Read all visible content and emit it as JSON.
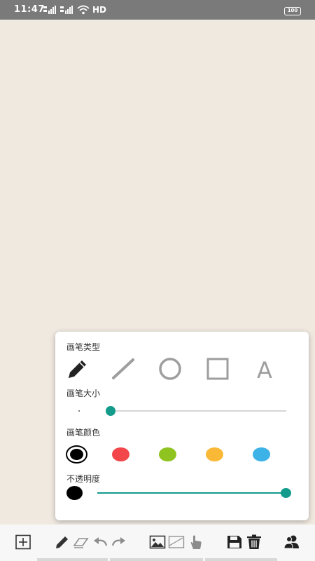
{
  "status_bar": {
    "time": "11:47",
    "network": "HD",
    "battery": "100"
  },
  "pen_panel": {
    "type_label": "画笔类型",
    "size_label": "画笔大小",
    "color_label": "画笔颜色",
    "opacity_label": "不透明度",
    "tools": [
      {
        "name": "pencil",
        "icon": "pencil-icon",
        "selected": true
      },
      {
        "name": "line",
        "icon": "line-icon",
        "selected": false
      },
      {
        "name": "circle",
        "icon": "circle-icon",
        "selected": false
      },
      {
        "name": "rectangle",
        "icon": "rectangle-icon",
        "selected": false
      },
      {
        "name": "text",
        "icon": "text-icon",
        "glyph": "A",
        "selected": false
      }
    ],
    "size_value": 0.03,
    "colors": [
      {
        "name": "black",
        "hex": "#000000",
        "selected": true
      },
      {
        "name": "red",
        "hex": "#f2464a",
        "selected": false
      },
      {
        "name": "green",
        "hex": "#8fc31f",
        "selected": false
      },
      {
        "name": "orange",
        "hex": "#f9b936",
        "selected": false
      },
      {
        "name": "blue",
        "hex": "#3db2e6",
        "selected": false
      }
    ],
    "opacity_value": 1.0,
    "accent_color": "#139b8c"
  },
  "toolbar": {
    "buttons": [
      "add-page-icon",
      "pencil-icon",
      "eraser-icon",
      "undo-icon",
      "redo-icon",
      "image-icon",
      "background-icon",
      "hand-icon",
      "save-icon",
      "delete-icon",
      "users-icon"
    ]
  },
  "canvas": {
    "background": "#f0e9e0"
  }
}
